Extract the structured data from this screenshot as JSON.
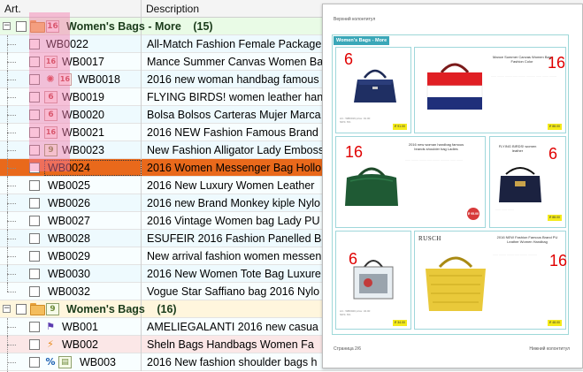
{
  "columns": {
    "art": "Art.",
    "description": "Description"
  },
  "groups": [
    {
      "title": "Women's Bags - More",
      "count": "(15)",
      "badge": "16"
    },
    {
      "title": "Women's Bags",
      "count": "(16)",
      "badge": "9"
    }
  ],
  "rows": [
    {
      "code": "WB0022",
      "badge": "",
      "desc": "All-Match Fashion Female Package"
    },
    {
      "code": "WB0017",
      "badge": "16",
      "desc": "Mance Summer Canvas Women Bag"
    },
    {
      "code": "WB0018",
      "badge": "16",
      "desc": "2016 new woman handbag famous"
    },
    {
      "code": "WB0019",
      "badge": "6",
      "desc": "FLYING BIRDS! women leather hand"
    },
    {
      "code": "WB0020",
      "badge": "6",
      "desc": "Bolsa Bolsos Carteras Mujer Marca"
    },
    {
      "code": "WB0021",
      "badge": "16",
      "desc": "2016 NEW Fashion Famous Brand"
    },
    {
      "code": "WB0023",
      "badge": "9",
      "desc": "New Fashion Alligator Lady Emboss"
    },
    {
      "code": "WB0024",
      "badge": "",
      "desc": "2016 Women Messenger Bag Hollo"
    },
    {
      "code": "WB0025",
      "badge": "",
      "desc": "2016 New Luxury Women Leather"
    },
    {
      "code": "WB0026",
      "badge": "",
      "desc": "2016 new Brand Monkey kiple Nylo"
    },
    {
      "code": "WB0027",
      "badge": "",
      "desc": "2016 Vintage Women bag Lady PU"
    },
    {
      "code": "WB0028",
      "badge": "",
      "desc": "ESUFEIR 2016 Fashion Panelled B"
    },
    {
      "code": "WB0029",
      "badge": "",
      "desc": "New arrival fashion women messen"
    },
    {
      "code": "WB0030",
      "badge": "",
      "desc": "2016 New Women Tote Bag Luxure"
    },
    {
      "code": "WB0032",
      "badge": "",
      "desc": "Vogue Star Saffiano bag 2016 Nylo"
    },
    {
      "code": "WB001",
      "badge": "",
      "desc": "AMELIEGALANTI 2016 new casua"
    },
    {
      "code": "WB002",
      "badge": "",
      "desc": "Sheln Bags Handbags Women Fa"
    },
    {
      "code": "WB003",
      "badge": "",
      "desc": "2016 New fashion shoulder bags h"
    }
  ],
  "preview": {
    "header": "Верхний колонтитул",
    "footer_left": "Страница 2/6",
    "footer_right": "Нижний колонтитул",
    "group_label": "Women's Bags - More",
    "cards": [
      {
        "num": "6",
        "title": "",
        "price": "₽ 91.00",
        "text": "Art.: WB0019 price: 91.00 NDS: 6%"
      },
      {
        "num": "16",
        "title": "Mance Summer Canvas Women Bag Fashion Color",
        "price": "₽ 88.00",
        "text": ""
      },
      {
        "num": "16",
        "title": "2016 new woman handbag famous brands shoulder bag Ladies",
        "price": "",
        "text": "",
        "stamp": "₽ 95.00"
      },
      {
        "num": "6",
        "title": "FLYING BIRDS! women leather",
        "price": "₽ 88.00",
        "text": ""
      },
      {
        "num": "6",
        "title": "",
        "price": "₽ 34.00",
        "text": "Art.: WB0020 price: 34.00 NDS: 6%"
      },
      {
        "num": "16",
        "title": "2016 NEW Fashion Famous Brand PU Leather Women Handbag",
        "price": "₽ 48.00",
        "text": "",
        "logo": "RUSCH"
      }
    ]
  },
  "colors": {
    "selected": "#e9691b",
    "group_green": "#e9fbe6",
    "group_yellow": "#fff6dd",
    "accent": "#3aa7b8",
    "number_red": "#e00000"
  }
}
